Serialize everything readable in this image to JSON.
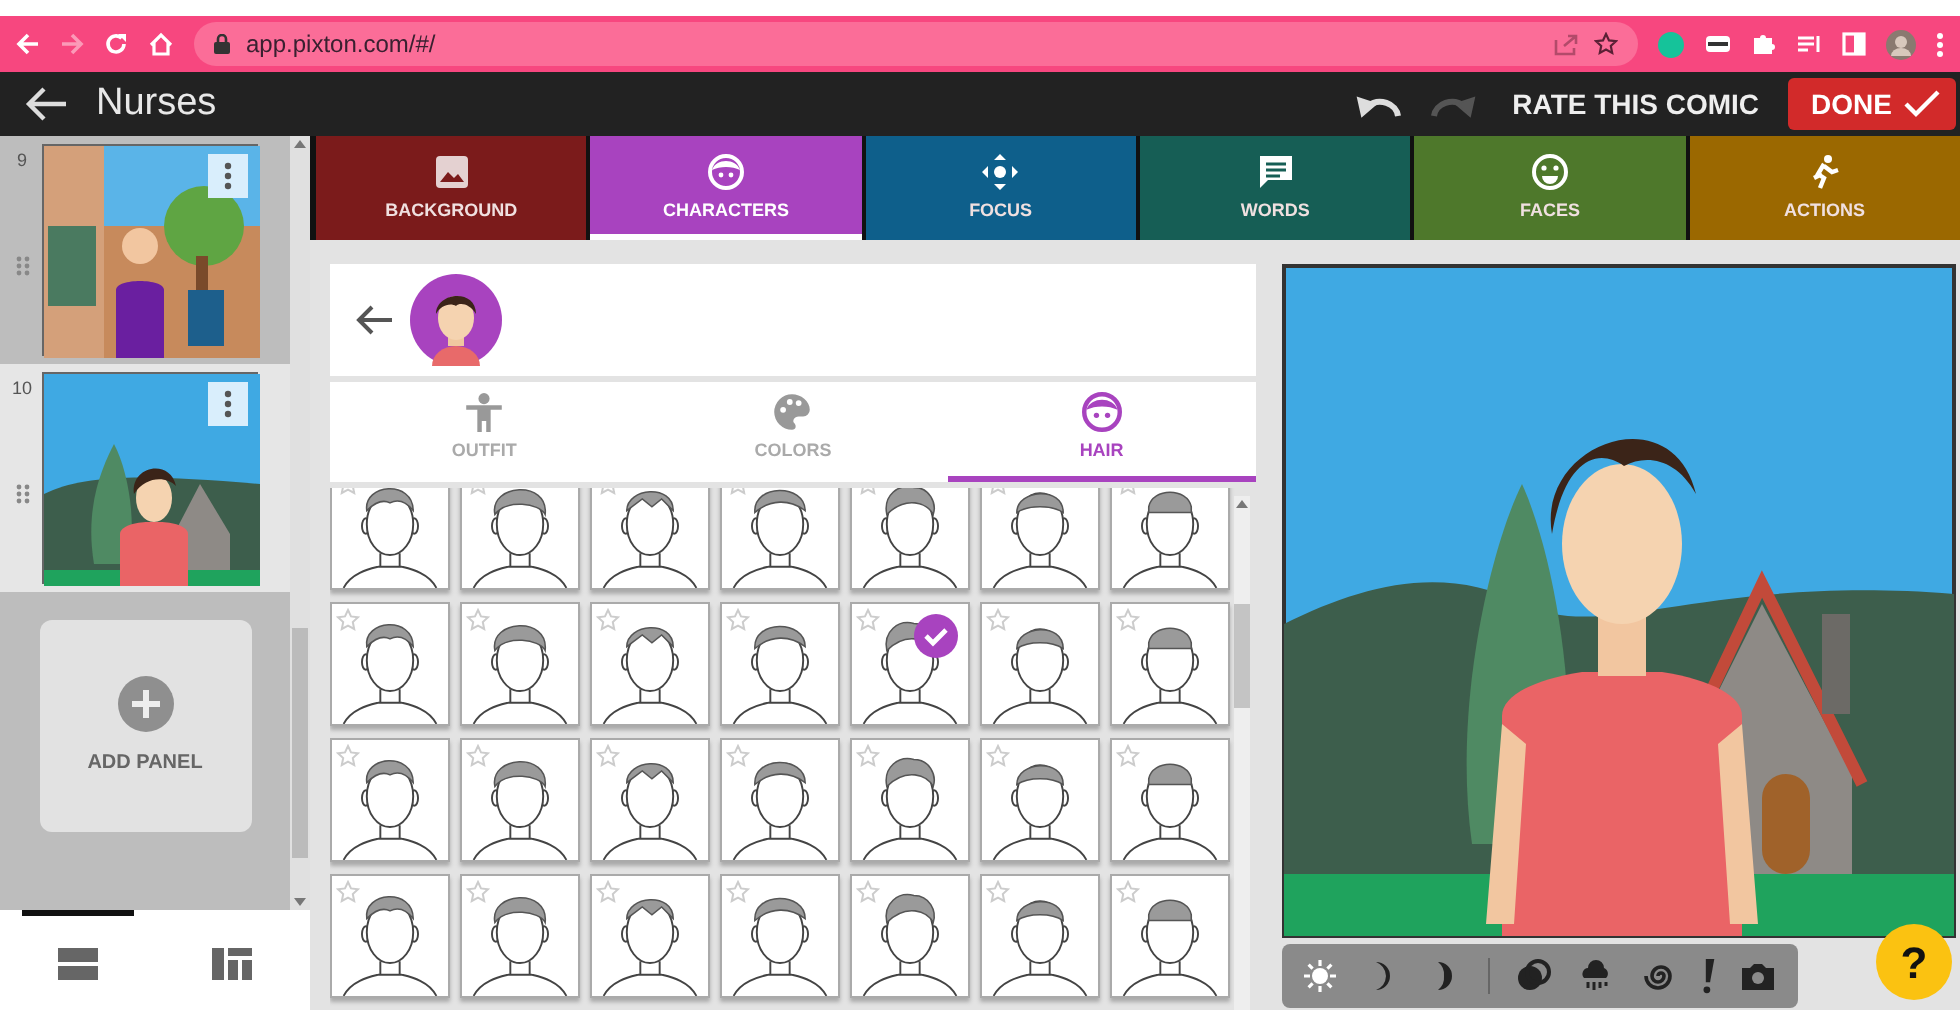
{
  "browser": {
    "url": "app.pixton.com/#/",
    "forward_disabled": true
  },
  "header": {
    "title": "Nurses",
    "undo_disabled": false,
    "redo_disabled": true,
    "rate_label": "RATE THIS COMIC",
    "done_label": "DONE"
  },
  "panels": [
    {
      "number": "9",
      "selected": false
    },
    {
      "number": "10",
      "selected": true
    }
  ],
  "add_panel": {
    "label": "ADD PANEL"
  },
  "layout_views": [
    {
      "selected": true
    },
    {
      "selected": false
    }
  ],
  "tabs": [
    {
      "label": "BACKGROUND",
      "color": "#7b1b1b",
      "selected": false
    },
    {
      "label": "CHARACTERS",
      "color": "#a843bf",
      "selected": true
    },
    {
      "label": "FOCUS",
      "color": "#0e5f8b",
      "selected": false
    },
    {
      "label": "WORDS",
      "color": "#165e55",
      "selected": false
    },
    {
      "label": "FACES",
      "color": "#4e782b",
      "selected": false
    },
    {
      "label": "ACTIONS",
      "color": "#9b6800",
      "selected": false
    }
  ],
  "subtabs": [
    {
      "label": "OUTFIT",
      "selected": false
    },
    {
      "label": "COLORS",
      "selected": false
    },
    {
      "label": "HAIR",
      "selected": true
    }
  ],
  "hair_options": [
    {
      "selected": false
    },
    {
      "selected": false
    },
    {
      "selected": false
    },
    {
      "selected": false
    },
    {
      "selected": false
    },
    {
      "selected": false
    },
    {
      "selected": false
    },
    {
      "selected": false
    },
    {
      "selected": false
    },
    {
      "selected": false
    },
    {
      "selected": false
    },
    {
      "selected": true
    },
    {
      "selected": false
    },
    {
      "selected": false
    },
    {
      "selected": false
    },
    {
      "selected": false
    },
    {
      "selected": false
    },
    {
      "selected": false
    },
    {
      "selected": false
    },
    {
      "selected": false
    },
    {
      "selected": false
    },
    {
      "selected": false
    },
    {
      "selected": false
    },
    {
      "selected": false
    },
    {
      "selected": false
    },
    {
      "selected": false
    },
    {
      "selected": false
    },
    {
      "selected": false
    }
  ],
  "scene_tools": [
    {
      "kind": "sun",
      "selected": true
    },
    {
      "kind": "moon",
      "selected": false
    },
    {
      "kind": "crescent",
      "selected": false
    },
    {
      "kind": "divider"
    },
    {
      "kind": "overlap",
      "selected": false
    },
    {
      "kind": "rain",
      "selected": false
    },
    {
      "kind": "spiral",
      "selected": false
    },
    {
      "kind": "exclaim",
      "selected": false
    },
    {
      "kind": "camera",
      "selected": false
    }
  ],
  "help": {
    "label": "?"
  }
}
